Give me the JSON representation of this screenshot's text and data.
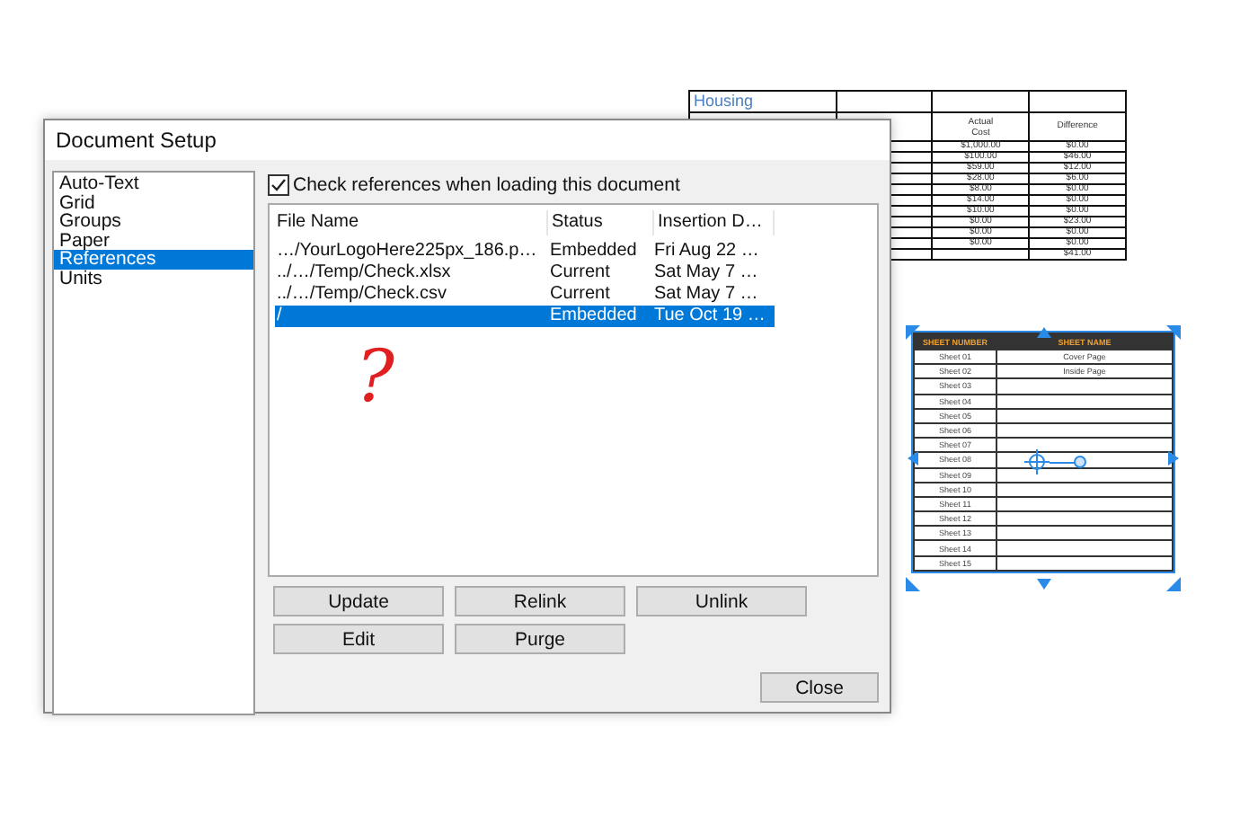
{
  "canvas": {
    "housing_table": {
      "title": "Housing",
      "columns": [
        "Actual Cost",
        "Difference"
      ],
      "rows": [
        {
          "actual": "$1,000.00",
          "difference": "$0.00"
        },
        {
          "actual": "$100.00",
          "difference": "$46.00"
        },
        {
          "actual": "$59.00",
          "difference": "$12.00"
        },
        {
          "actual": "$28.00",
          "difference": "$6.00"
        },
        {
          "actual": "$8.00",
          "difference": "$0.00"
        },
        {
          "actual": "$14.00",
          "difference": "$0.00"
        },
        {
          "actual": "$10.00",
          "difference": "$0.00"
        },
        {
          "actual": "$0.00",
          "difference": "$23.00"
        },
        {
          "actual": "$0.00",
          "difference": "$0.00"
        },
        {
          "actual": "$0.00",
          "difference": "$0.00"
        },
        {
          "difference": "$41.00"
        }
      ]
    },
    "sheet_index": {
      "selected": true,
      "columns": [
        "SHEET NUMBER",
        "SHEET NAME"
      ],
      "rows": [
        {
          "number": "Sheet 01",
          "name": "Cover Page"
        },
        {
          "number": "Sheet 02",
          "name": "Inside Page"
        },
        {
          "number": "Sheet 03"
        },
        {
          "number": "Sheet 04"
        },
        {
          "number": "Sheet 05"
        },
        {
          "number": "Sheet 06"
        },
        {
          "number": "Sheet 07"
        },
        {
          "number": "Sheet 08"
        },
        {
          "number": "Sheet 09"
        },
        {
          "number": "Sheet 10"
        },
        {
          "number": "Sheet 11"
        },
        {
          "number": "Sheet 12"
        },
        {
          "number": "Sheet 13"
        },
        {
          "number": "Sheet 14"
        },
        {
          "number": "Sheet 15"
        }
      ]
    }
  },
  "dialog": {
    "title": "Document Setup",
    "categories": [
      {
        "label": "Auto-Text",
        "selected": false
      },
      {
        "label": "Grid",
        "selected": false
      },
      {
        "label": "Groups",
        "selected": false
      },
      {
        "label": "Paper",
        "selected": false
      },
      {
        "label": "References",
        "selected": true
      },
      {
        "label": "Units",
        "selected": false
      }
    ],
    "check_references": {
      "label": "Check references when loading this document",
      "checked": true
    },
    "references": {
      "columns": [
        "File Name",
        "Status",
        "Insertion D…"
      ],
      "rows": [
        {
          "file_name": "…/YourLogoHere225px_186.p…",
          "status": "Embedded",
          "inserted": "Fri Aug 22 …",
          "selected": false
        },
        {
          "file_name": "../…/Temp/Check.xlsx",
          "status": "Current",
          "inserted": "Sat May  7 …",
          "selected": false
        },
        {
          "file_name": "../…/Temp/Check.csv",
          "status": "Current",
          "inserted": "Sat May  7 …",
          "selected": false
        },
        {
          "file_name": "/",
          "status": "Embedded",
          "inserted": "Tue Oct 19 …",
          "selected": true
        }
      ]
    },
    "annotation": "?",
    "buttons": [
      {
        "label": "Update"
      },
      {
        "label": "Relink"
      },
      {
        "label": "Unlink"
      },
      {
        "label": "Edit"
      },
      {
        "label": "Purge"
      }
    ],
    "close_button": "Close"
  }
}
